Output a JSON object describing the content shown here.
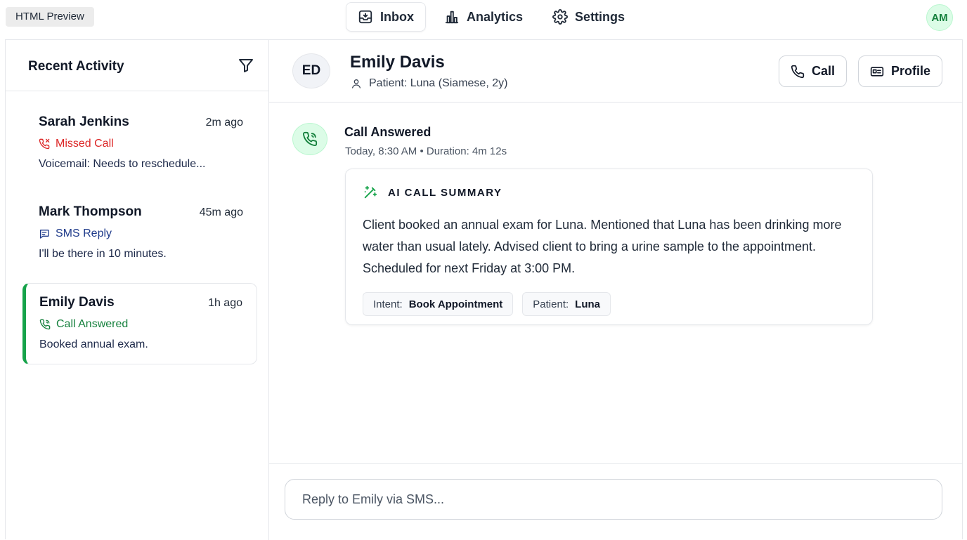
{
  "preview_tag": "HTML Preview",
  "nav": {
    "inbox": "Inbox",
    "analytics": "Analytics",
    "settings": "Settings"
  },
  "user": {
    "initials": "AM"
  },
  "sidebar": {
    "title": "Recent Activity",
    "items": [
      {
        "name": "Sarah Jenkins",
        "time": "2m ago",
        "status": "Missed Call",
        "status_icon": "phone-missed-icon",
        "preview": "Voicemail: Needs to reschedule..."
      },
      {
        "name": "Mark Thompson",
        "time": "45m ago",
        "status": "SMS Reply",
        "status_icon": "message-icon",
        "preview": "I'll be there in 10 minutes."
      },
      {
        "name": "Emily Davis",
        "time": "1h ago",
        "status": "Call Answered",
        "status_icon": "phone-incoming-icon",
        "preview": "Booked annual exam."
      }
    ]
  },
  "conversation": {
    "initials": "ED",
    "name": "Emily Davis",
    "patient": "Patient: Luna (Siamese, 2y)",
    "call_label": "Call",
    "profile_label": "Profile",
    "event": {
      "title": "Call Answered",
      "meta": "Today, 8:30 AM • Duration: 4m 12s",
      "summary_title": "AI CALL SUMMARY",
      "summary_text": "Client booked an annual exam for Luna. Mentioned that Luna has been drinking more water than usual lately. Advised client to bring a urine sample to the appointment. Scheduled for next Friday at 3:00 PM.",
      "tags": [
        {
          "key": "Intent:",
          "value": "Book Appointment"
        },
        {
          "key": "Patient:",
          "value": "Luna"
        }
      ]
    },
    "reply_placeholder": "Reply to Emily via SMS..."
  },
  "colors": {
    "accent_green": "#16a34a",
    "missed_red": "#dc2626",
    "sms_navy": "#1e3a8a"
  }
}
